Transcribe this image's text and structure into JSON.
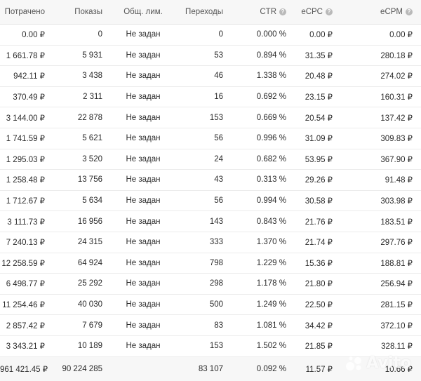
{
  "table": {
    "headers": {
      "spent": "Потрачено",
      "impressions": "Показы",
      "limit": "Общ. лим.",
      "clicks": "Переходы",
      "ctr": "CTR",
      "ecpc": "eCPC",
      "ecpm": "eCPM"
    },
    "rows": [
      [
        "0.00 ₽",
        "0",
        "Не задан",
        "0",
        "0.000 %",
        "0.00 ₽",
        "0.00 ₽"
      ],
      [
        "1 661.78 ₽",
        "5 931",
        "Не задан",
        "53",
        "0.894 %",
        "31.35 ₽",
        "280.18 ₽"
      ],
      [
        "942.11 ₽",
        "3 438",
        "Не задан",
        "46",
        "1.338 %",
        "20.48 ₽",
        "274.02 ₽"
      ],
      [
        "370.49 ₽",
        "2 311",
        "Не задан",
        "16",
        "0.692 %",
        "23.15 ₽",
        "160.31 ₽"
      ],
      [
        "3 144.00 ₽",
        "22 878",
        "Не задан",
        "153",
        "0.669 %",
        "20.54 ₽",
        "137.42 ₽"
      ],
      [
        "1 741.59 ₽",
        "5 621",
        "Не задан",
        "56",
        "0.996 %",
        "31.09 ₽",
        "309.83 ₽"
      ],
      [
        "1 295.03 ₽",
        "3 520",
        "Не задан",
        "24",
        "0.682 %",
        "53.95 ₽",
        "367.90 ₽"
      ],
      [
        "1 258.48 ₽",
        "13 756",
        "Не задан",
        "43",
        "0.313 %",
        "29.26 ₽",
        "91.48 ₽"
      ],
      [
        "1 712.67 ₽",
        "5 634",
        "Не задан",
        "56",
        "0.994 %",
        "30.58 ₽",
        "303.98 ₽"
      ],
      [
        "3 111.73 ₽",
        "16 956",
        "Не задан",
        "143",
        "0.843 %",
        "21.76 ₽",
        "183.51 ₽"
      ],
      [
        "7 240.13 ₽",
        "24 315",
        "Не задан",
        "333",
        "1.370 %",
        "21.74 ₽",
        "297.76 ₽"
      ],
      [
        "12 258.59 ₽",
        "64 924",
        "Не задан",
        "798",
        "1.229 %",
        "15.36 ₽",
        "188.81 ₽"
      ],
      [
        "6 498.77 ₽",
        "25 292",
        "Не задан",
        "298",
        "1.178 %",
        "21.80 ₽",
        "256.94 ₽"
      ],
      [
        "11 254.46 ₽",
        "40 030",
        "Не задан",
        "500",
        "1.249 %",
        "22.50 ₽",
        "281.15 ₽"
      ],
      [
        "2 857.42 ₽",
        "7 679",
        "Не задан",
        "83",
        "1.081 %",
        "34.42 ₽",
        "372.10 ₽"
      ],
      [
        "3 343.21 ₽",
        "10 189",
        "Не задан",
        "153",
        "1.502 %",
        "21.85 ₽",
        "328.11 ₽"
      ]
    ],
    "totals": [
      "961 421.45 ₽",
      "90 224 285",
      "",
      "83 107",
      "0.092 %",
      "11.57 ₽",
      "10.66 ₽"
    ]
  },
  "icons": {
    "help": "question-circle-icon"
  },
  "watermark": {
    "text": "Avito"
  },
  "colors": {
    "header_bg": "#f7f7f7",
    "text": "#2b2b2b",
    "help_icon": "#b9b9b9"
  }
}
